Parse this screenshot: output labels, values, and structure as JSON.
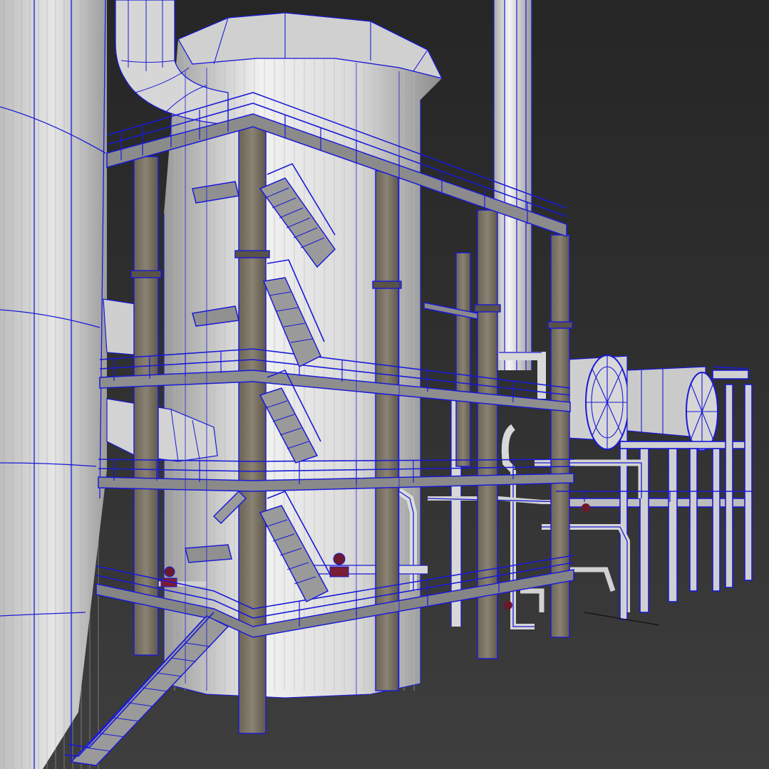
{
  "viewport": {
    "render_mode": "wireframe-over-shaded",
    "wire_color": "#1a1ad8",
    "background_color": "#2c2c2c",
    "steel_color": "#d8d8d8",
    "concrete_color": "#7b7365"
  }
}
